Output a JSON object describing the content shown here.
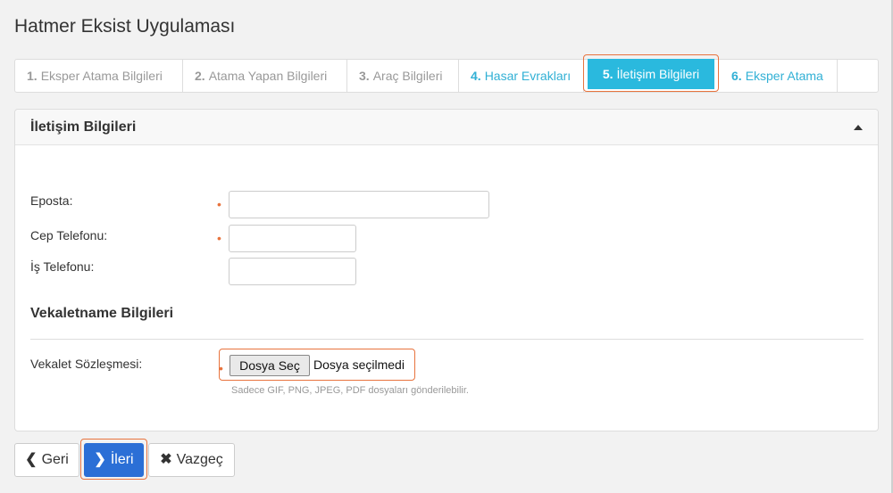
{
  "app": {
    "title": "Hatmer Eksist Uygulaması"
  },
  "wizard": {
    "steps": [
      {
        "num": "1.",
        "label": "Eksper Atama Bilgileri",
        "state": "upcoming"
      },
      {
        "num": "2.",
        "label": "Atama Yapan Bilgileri",
        "state": "upcoming"
      },
      {
        "num": "3.",
        "label": "Araç Bilgileri",
        "state": "upcoming"
      },
      {
        "num": "4.",
        "label": "Hasar Evrakları",
        "state": "done"
      },
      {
        "num": "5.",
        "label": "İletişim Bilgileri",
        "state": "active"
      },
      {
        "num": "6.",
        "label": "Eksper Atama",
        "state": "done"
      }
    ]
  },
  "panel": {
    "title": "İletişim Bilgileri",
    "collapse_icon": "caret-up-icon"
  },
  "form": {
    "email": {
      "label": "Eposta:",
      "required": "•",
      "value": ""
    },
    "mobile": {
      "label": "Cep Telefonu:",
      "required": "•",
      "value": ""
    },
    "work_phone": {
      "label": "İş Telefonu:",
      "value": ""
    }
  },
  "proxy": {
    "title": "Vekaletname Bilgileri",
    "contract": {
      "label": "Vekalet Sözleşmesi:",
      "required": "•",
      "button_label": "Dosya Seç",
      "status": "Dosya seçilmedi",
      "help": "Sadece GIF, PNG, JPEG, PDF dosyaları gönderilebilir."
    }
  },
  "actions": {
    "back_label": "Geri",
    "back_icon": "chevron-left-icon",
    "next_label": "İleri",
    "next_icon": "chevron-right-icon",
    "cancel_label": "Vazgeç",
    "cancel_icon": "times-icon"
  },
  "colors": {
    "accent": "#2ab9de",
    "link": "#31b0d5",
    "primary": "#2b6fd6",
    "highlight": "#e8733d"
  }
}
